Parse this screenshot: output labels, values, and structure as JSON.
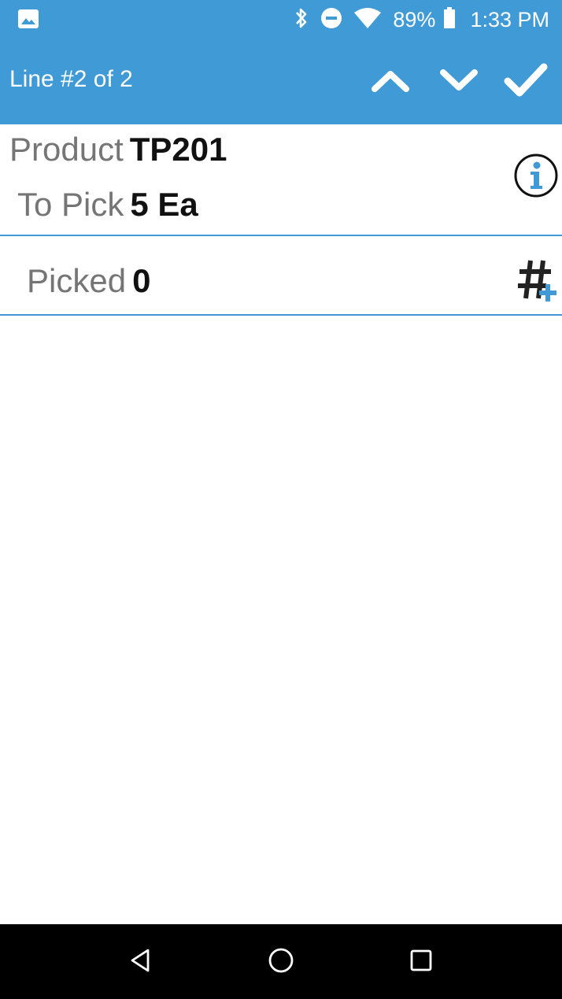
{
  "status_bar": {
    "battery_percent": "89%",
    "time": "1:33 PM",
    "icons": [
      "image-notification-icon",
      "bluetooth-icon",
      "do-not-disturb-icon",
      "wifi-icon",
      "battery-icon"
    ]
  },
  "app_bar": {
    "title": "Line #2 of 2",
    "actions": [
      "previous-line",
      "next-line",
      "confirm"
    ]
  },
  "product": {
    "product_label": "Product",
    "product_value": "TP201",
    "to_pick_label": "To Pick",
    "to_pick_value": "5 Ea"
  },
  "picked": {
    "label": "Picked",
    "value": "0"
  },
  "nav_bar": {
    "buttons": [
      "back",
      "home",
      "recents"
    ]
  },
  "colors": {
    "primary": "#3f9ad6",
    "label_gray": "#757575",
    "value_black": "#111111",
    "nav_black": "#000000"
  }
}
